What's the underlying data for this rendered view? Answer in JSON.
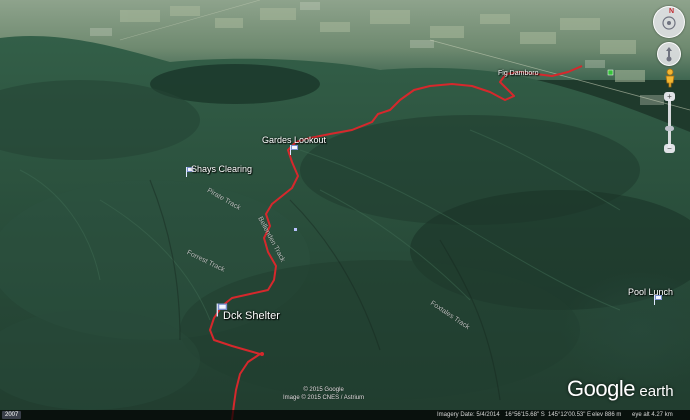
{
  "places": [
    {
      "name": "Fig Damboro"
    },
    {
      "name": "Gardes Lookout"
    },
    {
      "name": "Shays Clearing"
    },
    {
      "name": "Dck Shelter"
    },
    {
      "name": "Pool Lunch"
    }
  ],
  "tracks": [
    {
      "name": "Pirate Track"
    },
    {
      "name": "Bellenden Track"
    },
    {
      "name": "Forrest Track"
    },
    {
      "name": "Foxtales Track"
    }
  ],
  "copyright": {
    "line1": "© 2015 Google",
    "line2": "Image © 2015 CNES / Astrium"
  },
  "logo": {
    "word1": "Google",
    "word2": "earth"
  },
  "status": {
    "year": "2007",
    "imagery_date": "Imagery Date: 5/4/2014",
    "lat": "16°56'15.68\" S",
    "lon": "145°12'00.53\" E",
    "elev": "elev  886 m",
    "eye_alt": "eye alt  4.27 km"
  },
  "nav": {
    "north_letter": "N",
    "zoom_in": "+",
    "zoom_out": "−"
  },
  "colors": {
    "route": "#d6282c",
    "forest_dark": "#1d3528",
    "forest_mid": "#2f5a44",
    "valley_light": "#8fa88a"
  }
}
